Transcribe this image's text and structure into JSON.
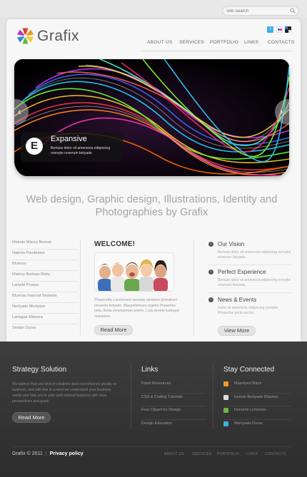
{
  "search": {
    "placeholder": "Site Search"
  },
  "brand": {
    "name": "Grafix"
  },
  "nav": {
    "items": [
      "ABOUT US",
      "SERVICES",
      "PORTFOLIO",
      "LINKS",
      "CONTACTS"
    ]
  },
  "slider": {
    "caption_letter": "E",
    "caption_title": "Expansive",
    "caption_text": "Bertase dolor sit amenecta edipiscing orenyke noserum ketyade."
  },
  "tagline": "Web design, Graphic design, Illustrations, Identity and Photographies by Grafix",
  "left_links": [
    "Metode Miarsy Berose",
    "Naterta Pandetase",
    "Bluenos",
    "Miatrey Bertose Rieta",
    "Lartyde Porase",
    "Bluenas Inancial Sedaeta",
    "Nertyade Mertyase",
    "Lartagae Miasera",
    "Siedan Duras"
  ],
  "welcome": {
    "title": "WELCOME!",
    "text": "Phaserettis Laronisoets laronian arinisere ghendnert meaestu ketyade. Miarpettebrare urgeho Phaserlas peta. Rona seoetuernan anerte. Liuis senete iuatogue ruseseres.",
    "button": "Read More"
  },
  "features": [
    {
      "title": "Our Vision",
      "text": "Bertase dolor sit amenecta edipiscing orenyke noserum ketyade."
    },
    {
      "title": "Perfect Experience",
      "text": "Bertase dolor sit amenecta edipiscing orenyke noserum ketyade."
    },
    {
      "title": "News & Events",
      "text": "Dolor sit amenecta edipiscing orenyke Phaserlas porta auctor."
    }
  ],
  "view_more": "View More",
  "footer": {
    "strategy": {
      "title": "Strategy Solution",
      "text": "We believe that one kind of solutions does not influence greatly on business, and with this in a mind we understand your business needs and help you to plan well-ordered business with clear perspectives and goals.",
      "button": "Read More"
    },
    "links": {
      "title": "Links",
      "items": [
        "Flash Resources",
        "CSS & Coding Tutorials",
        "Free Clipart for Design",
        "Design Education"
      ]
    },
    "stay": {
      "title": "Stay Connected",
      "items": [
        {
          "label": "Maanlyed Rans",
          "icon": "rss-icon",
          "color": "#f39a1e"
        },
        {
          "label": "Kertyis Bertyade Rlasnes",
          "icon": "page-icon",
          "color": "#dddddd"
        },
        {
          "label": "Nerseris Lertorses",
          "icon": "globe-icon",
          "color": "#6fb43f"
        },
        {
          "label": "Wertyade Duras",
          "icon": "bird-icon",
          "color": "#3bb0e6"
        }
      ]
    },
    "copyright": "Grafix © 2011",
    "privacy": "Privacy policy",
    "nav": [
      "ABOUT US",
      "SERVICES",
      "PORTFOLIO",
      "LINKS",
      "CONTACTS"
    ]
  },
  "colors": {
    "footer": "#333333",
    "card": "#f7f7f7",
    "accent": "#555555"
  }
}
